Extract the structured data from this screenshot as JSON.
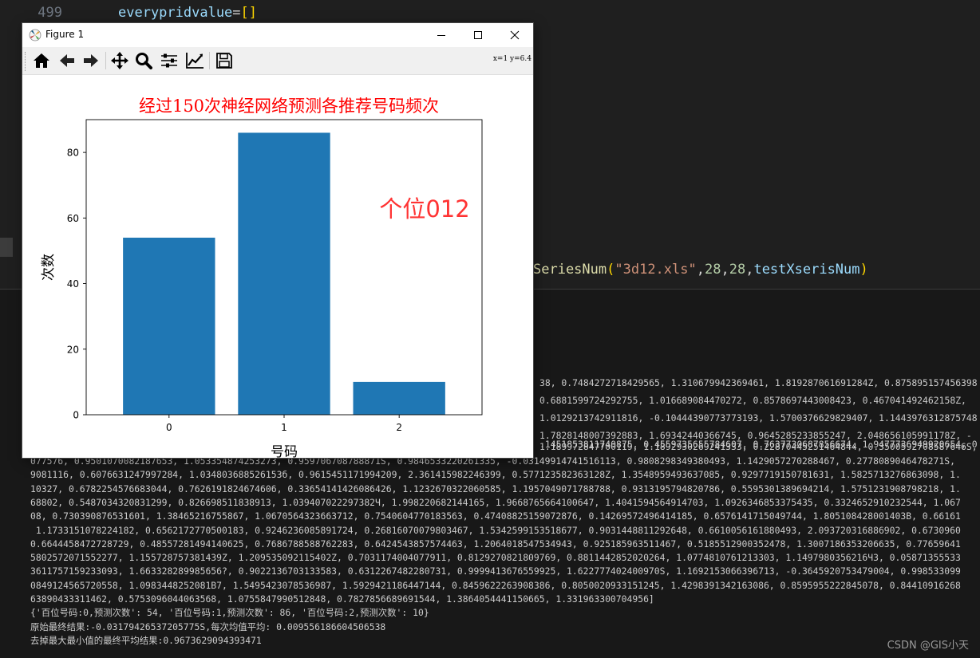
{
  "editor": {
    "line_number": "499",
    "code_var": "everypridvalue",
    "code_eq": "=",
    "code_brackets": "[]",
    "call_fn": "SeriesNum",
    "call_open": "(",
    "call_str": "\"3d12.xls\"",
    "call_comma1": ",",
    "call_n1": "28",
    "call_comma2": ",",
    "call_n2": "28",
    "call_comma3": ",",
    "call_arg": "testXserisNum",
    "call_close": ")"
  },
  "figure": {
    "window_title": "Figure 1",
    "coord_readout": "x=1  y=6.4",
    "toolbar": [
      "home-icon",
      "back-icon",
      "forward-icon",
      "pan-icon",
      "zoom-icon",
      "configure-subplots-icon",
      "edit-axis-icon",
      "save-icon"
    ],
    "overlay_text": "个位012",
    "colors": {
      "bar": "#1f77b4",
      "title": "#ff0000",
      "overlay": "#ff3333"
    }
  },
  "chart_data": {
    "type": "bar",
    "title": "经过150次神经网络预测各推荐号码频次",
    "xlabel": "号码",
    "ylabel": "次数",
    "categories": [
      "0",
      "1",
      "2"
    ],
    "values": [
      54,
      86,
      10
    ],
    "ylim": [
      0,
      90
    ],
    "yticks": [
      0,
      20,
      40,
      60,
      80
    ],
    "grid": false
  },
  "terminal": {
    "right_fragments": [
      {
        "top": 473,
        "text": "38, 0.7484272718429565, 1.310679942369461, 1.819287061691284Z, 0.875895157456398"
      },
      {
        "top": 495,
        "text": "0.6881599724292755, 1.016689084470272, 0.857869744300842З, 0.467041492462158Z,"
      },
      {
        "top": 517,
        "text": "1.0129213742911816, -0.10444390773773193, 1.5700376629829407, 1.1443976312875748"
      },
      {
        "top": 539,
        "text": "1.7828148007392883, 1.69342440366745, 0.9645285233855247, 2.048656105991178Z, -"
      },
      {
        "top": 550,
        "text": ".1451853811740875, 0.4559735655784607, 0.7637730687856674, 1.9477736949920654, 0"
      },
      {
        "top": 553,
        "text": "1.189972847700119, 1.189293026924133З, 0.22870445251464844, 0.3500592708587646S,"
      }
    ],
    "lines": [
      "077576, 0.9501070082187653, 1.053354874253273, 0.959706708788871S, 0.9846533220261335, -0.03149914741516113, 0.9808298349380493, 1.1429057270288467, 0.2778089046478271S,",
      "9081116, 0.6076631247997284, 1.034803688526153б, 0.9615451171994209, 2.361415982246399, 0.577123582363128Z, 1.3548959493637085, 0.9297719150781631, 1.5825713276863098, 1.",
      "10327, 0.6782254576683044, 0.7626191824674606, 0.33654141426086426, 1.1232670322060585, 1.1957049071788788, 0.9313195794820786, 0.5595301389694214, 1.5751231908798218, 1.",
      "68802, 0.5487034320831299, 0.82669851183891З, 1.039407022297382Ч, 1.998220682144165, 1.9668765664100647, 1.4041594564914703, 1.0926346853375435, 0.3324652910232544, 1.067",
      "08, 0.730390876531601, 1.38465216755867, 1.0670564323663712, 0.7540604770183563, 0.47408825159072876, 0.14269572496414185, 0.6576141715049744, 1.805108428001403B, 0.66161",
      " 1.1733151078224182, 0.6562172770500183, 0.9246236085891724, 0.26816070079803467, 1.5342599153518677, 0.9031448811292648, 0.6610056161880493, 2.093720316886902, 0.6730960",
      "0.6644458472728729, 0.48557281494140625, 0.7686788588762283, 0.6424543857574463, 1.2064018547534943, 0.925185963511467, 0.5185512900352478, 1.3007186353206635, 0.77659641",
      "5802572071552277, 1.155728757381439Z, 1.209535092115402Z, 0.7031174004077911, 0.8129270821809769, 0.8811442852020264, 1.077481076121330З, 1.1497980356216Ч3, 0.05871355533",
      "3611757159233093, 1.663328289985656?, 0.902213670313358З, 0.6312267482280731, 0.9999413676559925, 1.622777402400970S, 1.1692153066396713, -0.3645920753479004, 0.998533099",
      "0849124565720558, 1.0983448252081B7, 1.5495423078536987, 1.5929421186447144, 0.8459622263908386, 0.8050020933151245, 1.4298391342163086, 0.8595955222845078, 0.84410916268",
      "63890433311462, 0.5753096044063568, 1.0755847990512848, 0.7827856689691544, 1.3864054441150665, 1.331963300704956]",
      "{'百位号码:0,预测次数': 54, '百位号码:1,预测次数': 86, '百位号码:2,预测次数': 10}",
      "原始最终结果:-0.03179426537205775S,每次均值平均: 0.009556186604506538",
      "去掉最大最小值的最终平均结果:0.9673629094393471"
    ],
    "watermark": "CSDN @GIS小天"
  }
}
